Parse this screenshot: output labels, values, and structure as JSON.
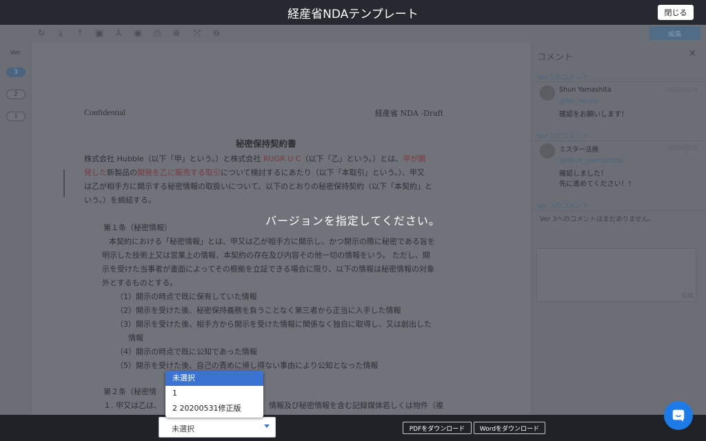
{
  "window": {
    "title": "経産省NDAテンプレート",
    "close_label": "閉じる"
  },
  "toolbar": {
    "icons": [
      "refresh-icon",
      "download-icon",
      "upload-icon",
      "save-icon",
      "sign-icon",
      "eye-icon",
      "print-icon",
      "zoom-in-icon",
      "fit-icon",
      "zoom-out-icon"
    ],
    "edit_label": "編集"
  },
  "versions": {
    "label": "Ver.",
    "items": [
      "3",
      "2",
      "1"
    ],
    "active": "3"
  },
  "document": {
    "header_left": "Confidential",
    "header_right": "経産省 NDA -Draft",
    "title": "秘密保持契約書",
    "preamble": [
      [
        "株式会社 Hubble（以下「甲」という。）と株式会社 ",
        "RUGR U C",
        "（以下「乙」という。）とは、",
        "甲が開"
      ],
      [
        "発した",
        "新製品の",
        "開発を乙に販売する取引",
        "について検討するにあたり（以下「本取引」という。）、甲又"
      ],
      [
        "は乙が相手方に開示する秘密情報の取扱いについて、以下のとおりの秘密保持契約（以下「本契約」と"
      ],
      [
        "いう。）を締結する。"
      ]
    ],
    "article1_title": "第１条（秘密情報）",
    "article1_body": [
      "本契約における「秘密情報」とは、甲又は乙が相手方に開示し、かつ開示の際に秘密である旨を",
      "明示した技術上又は営業上の情報、本契約の存在及び内容その他一切の情報をいう。 ただし、開",
      "示を受けた当事者が書面によってその根拠を立証できる場合に限り、以下の情報は秘密情報の対象",
      "外とするものとする。"
    ],
    "article1_items": [
      "（1）開示の時点で既に保有していた情報",
      "（2）開示を受けた後、秘密保持義務を負うことなく第三者から正当に入手した情報",
      "（3）開示を受けた後、相手方から開示を受けた情報に関係なく独自に取得し、又は創出した",
      "情報",
      "（4）開示の時点で既に公知であった情報",
      "（5）開示を受けた後、自己の責めに帰し得ない事由により公知となった情報"
    ],
    "article2_title": "第２条（秘密情",
    "article2_line": "１. 甲又は乙は、",
    "article2_line_tail": "情報及び秘密情報を含む記録媒体若しくは物件（複"
  },
  "comments": {
    "title": "コメント",
    "sections": [
      {
        "label": "Ver 1のコメント",
        "entries": [
          {
            "name": "Shun Yamashita",
            "date": "2020/05/24",
            "mention": "@Mr_Home",
            "text": [
              "確認をお願いします！"
            ]
          }
        ]
      },
      {
        "label": "Ver 2のコメント",
        "entries": [
          {
            "name": "ミスター法務",
            "date": "2020/05/31",
            "mention": "@shun_yamashita",
            "text": [
              "確認しました！",
              "先に進めてください！！"
            ]
          }
        ]
      },
      {
        "label": "Ver 3のコメント",
        "empty": "Ver 3へのコメントはまだありません。"
      }
    ],
    "post_label": "投稿"
  },
  "overlay_message": "バージョンを指定してください。",
  "version_select": {
    "value": "未選択",
    "options": [
      "未選択",
      "1",
      "2 20200531修正版"
    ],
    "highlighted": "未選択"
  },
  "downloads": {
    "pdf_label": "PDFをダウンロード",
    "word_label": "Wordをダウンロード"
  },
  "colors": {
    "accent": "#3a73d1",
    "chat": "#1c7be6",
    "topbar": "#262a30"
  }
}
